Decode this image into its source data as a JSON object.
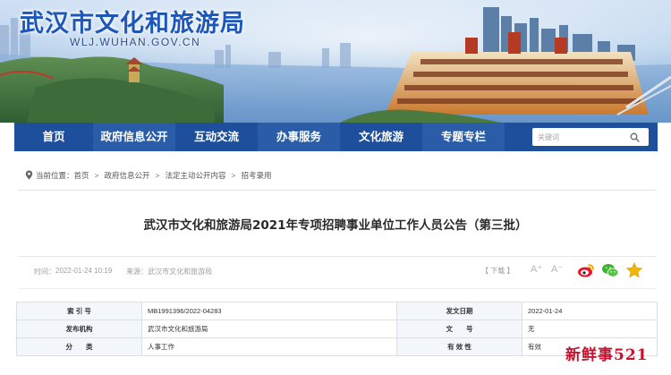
{
  "header": {
    "site_title": "武汉市文化和旅游局",
    "site_url": "WLJ.WUHAN.GOV.CN"
  },
  "nav": {
    "items": [
      {
        "label": "首页"
      },
      {
        "label": "政府信息公开"
      },
      {
        "label": "互动交流"
      },
      {
        "label": "办事服务"
      },
      {
        "label": "文化旅游"
      },
      {
        "label": "专题专栏"
      }
    ],
    "search_placeholder": "关键词",
    "search_icon": "search-icon"
  },
  "breadcrumb": {
    "location_label": "当前位置：",
    "items": [
      "首页",
      "政府信息公开",
      "法定主动公开内容",
      "招考录用"
    ],
    "separator": ">",
    "icon": "location-pin-icon"
  },
  "article": {
    "title": "武汉市文化和旅游局2021年专项招聘事业单位工作人员公告（第三批）",
    "time_label": "时间：",
    "time_value": "2022-01-24 10:19",
    "source_label": "来源：",
    "source_value": "武汉市文化和旅游局",
    "print_label": "【 下载 】",
    "font_large": "A⁺",
    "font_small": "A⁻",
    "share_icons": [
      "weibo-icon",
      "wechat-icon",
      "star-icon"
    ]
  },
  "info_table": {
    "rows": [
      {
        "k1": "索 引 号",
        "v1": "MB1991396/2022-04283",
        "k2": "发文日期",
        "v2": "2022-01-24"
      },
      {
        "k1": "发布机构",
        "v1": "武汉市文化和旅游局",
        "k2": "文　　号",
        "v2": "无"
      },
      {
        "k1": "分　　类",
        "v1": "人事工作",
        "k2": "有 效 性",
        "v2": "有效"
      }
    ]
  },
  "watermark": "新鲜事521",
  "colors": {
    "nav_bg": "#1d4f9c",
    "title_blue": "#1f57b8",
    "watermark_red": "#c8102e"
  }
}
